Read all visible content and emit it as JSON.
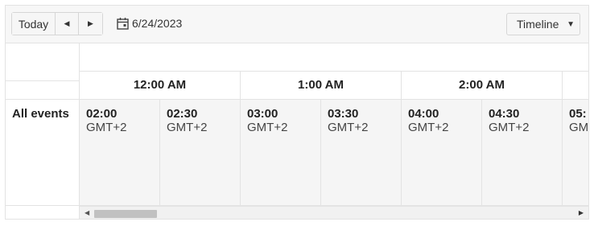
{
  "toolbar": {
    "today_label": "Today",
    "prev_glyph": "◀",
    "next_glyph": "▶",
    "date": "6/24/2023",
    "date_icon": "calendar-icon",
    "view": {
      "selected": "Timeline",
      "chevron": "⌄"
    }
  },
  "group": {
    "label": "All events"
  },
  "hours": [
    "12:00 AM",
    "1:00 AM",
    "2:00 AM",
    ""
  ],
  "slots": [
    {
      "time": "02:00",
      "zone": "GMT+2"
    },
    {
      "time": "02:30",
      "zone": "GMT+2"
    },
    {
      "time": "03:00",
      "zone": "GMT+2"
    },
    {
      "time": "03:30",
      "zone": "GMT+2"
    },
    {
      "time": "04:00",
      "zone": "GMT+2"
    },
    {
      "time": "04:30",
      "zone": "GMT+2"
    },
    {
      "time": "05:",
      "zone": "GM"
    }
  ],
  "scrollbar": {
    "left_glyph": "◀",
    "right_glyph": "▶",
    "position": 0.02
  }
}
